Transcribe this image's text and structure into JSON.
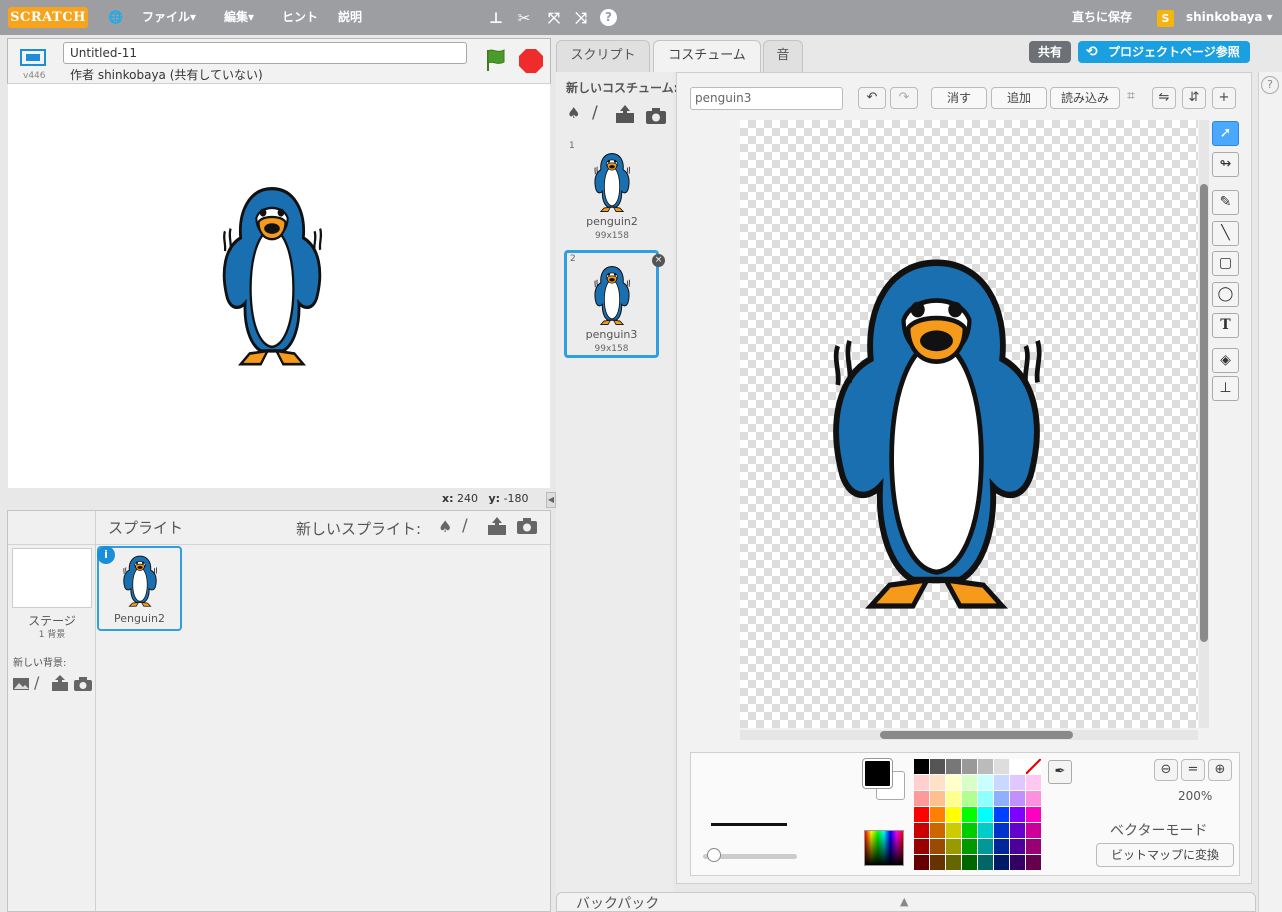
{
  "topbar": {
    "logo": "SCRATCH",
    "menu_file": "ファイル▾",
    "menu_edit": "編集▾",
    "menu_tips": "ヒント",
    "menu_about": "説明",
    "save_now": "直ちに保存",
    "username": "shinkobaya ▾"
  },
  "project": {
    "version": "v446",
    "title": "Untitled-11",
    "author_line": "作者 shinkobaya (共有していない)"
  },
  "stage": {
    "x_label": "x:",
    "x_value": "240",
    "y_label": "y:",
    "y_value": "-180"
  },
  "sprite_pane": {
    "header": "スプライト",
    "new_sprite": "新しいスプライト:",
    "stage_label": "ステージ",
    "stage_count": "1 背景",
    "new_backdrop": "新しい背景:",
    "sprites": [
      {
        "name": "Penguin2"
      }
    ]
  },
  "tabs": [
    "スクリプト",
    "コスチューム",
    "音"
  ],
  "share_button": "共有",
  "project_page_button": "プロジェクトページ参照",
  "new_costume": "新しいコスチューム:",
  "costumes": [
    {
      "index": "1",
      "name": "penguin2",
      "size": "99x158"
    },
    {
      "index": "2",
      "name": "penguin3",
      "size": "99x158"
    }
  ],
  "editor": {
    "costume_name": "penguin3",
    "clear": "消す",
    "add": "追加",
    "import": "読み込み",
    "zoom": "200%",
    "mode": "ベクターモード",
    "convert": "ビットマップに変換"
  },
  "backpack": "バックパック",
  "colors": {
    "accent": "#1aa0e0",
    "topbar": "#9c9ea2",
    "selected": "#2ea0e0",
    "stop": "#ee2c2c",
    "green_flag": "#4a9b2a"
  },
  "chart_data": null
}
